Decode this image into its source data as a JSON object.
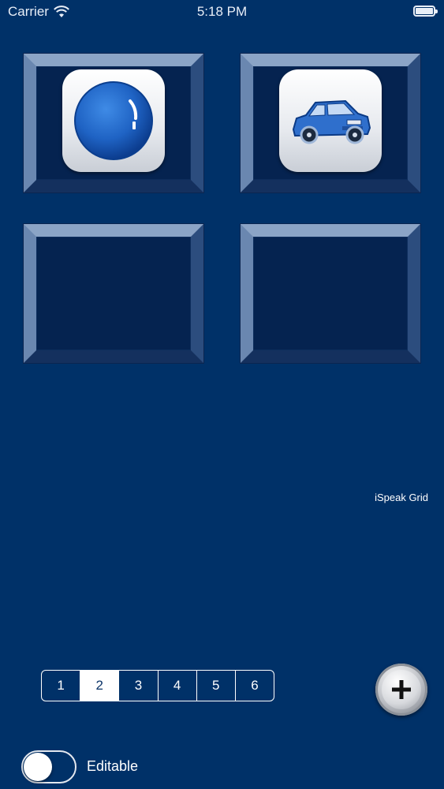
{
  "status_bar": {
    "carrier": "Carrier",
    "time": "5:18 PM",
    "icons": [
      "wifi-icon",
      "battery-icon"
    ]
  },
  "grid": {
    "tiles": [
      {
        "icon": "blue-circle-icon"
      },
      {
        "icon": "blue-car-icon"
      },
      {
        "icon": ""
      },
      {
        "icon": ""
      }
    ]
  },
  "app_label": "iSpeak Grid",
  "pager": {
    "pages": [
      "1",
      "2",
      "3",
      "4",
      "5",
      "6"
    ],
    "selected": "2"
  },
  "add_button": {
    "icon": "plus-icon"
  },
  "editable_toggle": {
    "label": "Editable",
    "on": false
  },
  "colors": {
    "background": "#003168",
    "tile": "#052350",
    "accent_blue": "#1e64c8"
  }
}
